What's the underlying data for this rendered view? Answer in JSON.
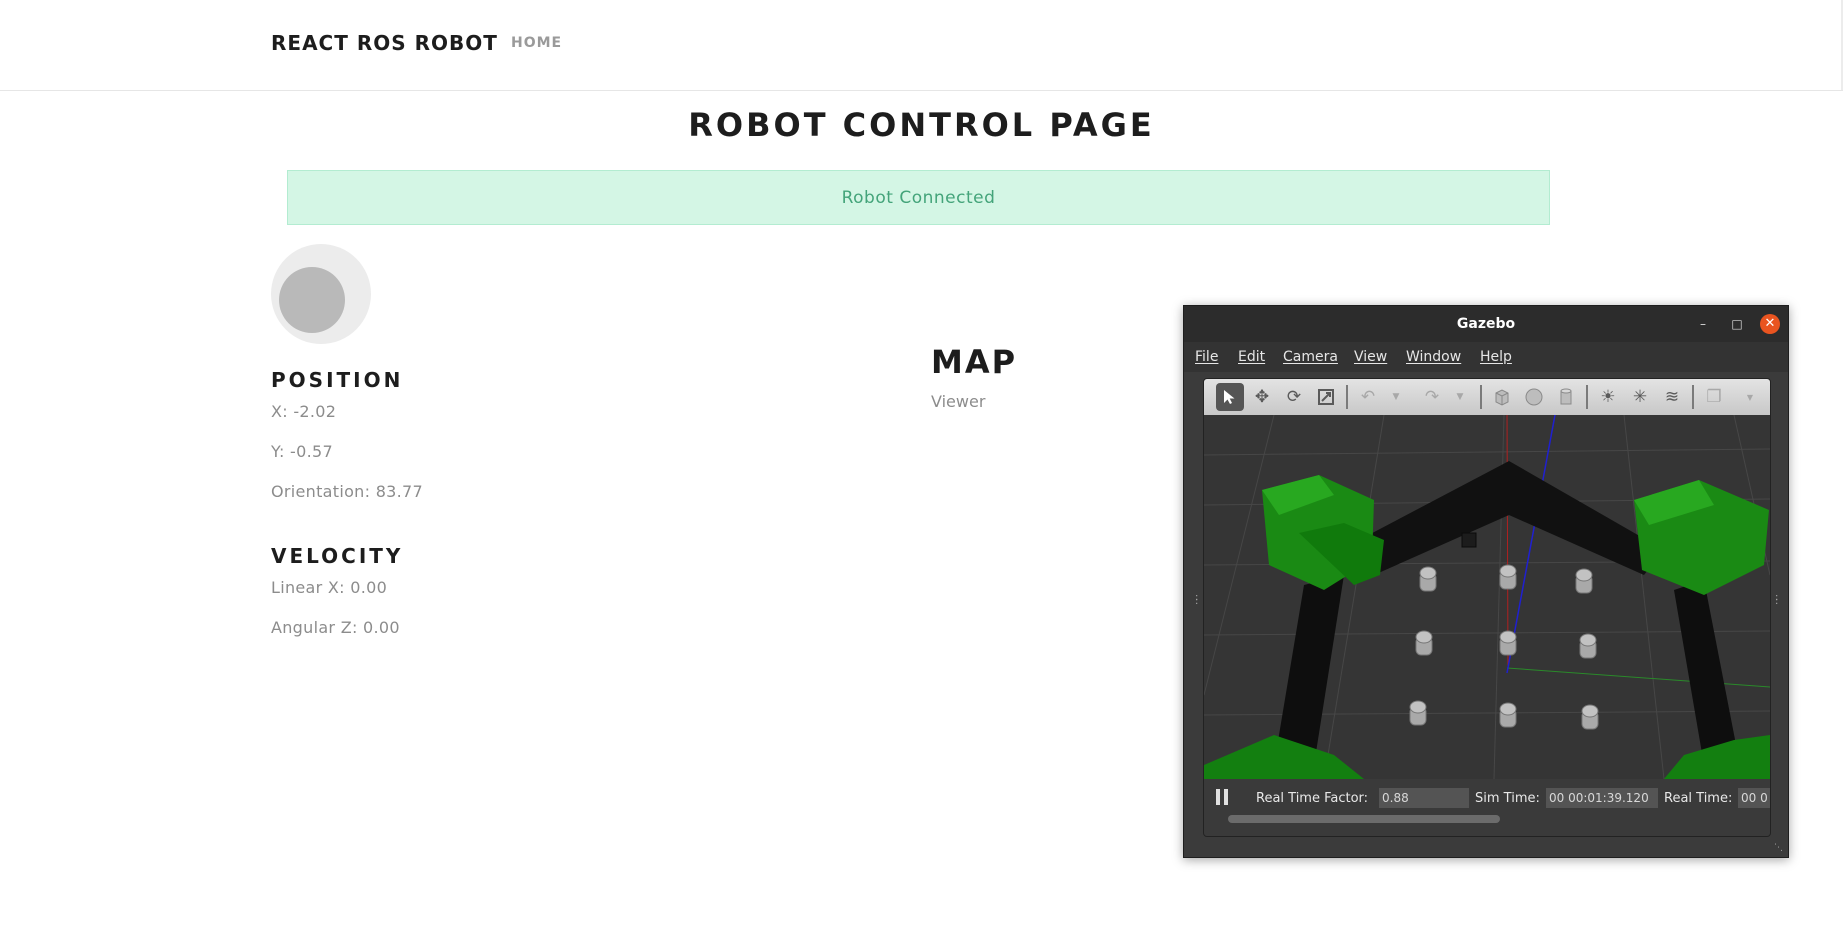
{
  "navbar": {
    "brand": "REACT ROS ROBOT",
    "home": "HOME"
  },
  "page": {
    "title": "ROBOT CONTROL PAGE",
    "alert": "Robot Connected"
  },
  "joystick": {
    "knob_offset": [
      0,
      0
    ]
  },
  "position": {
    "heading": "POSITION",
    "x": "X: -2.02",
    "y": "Y: -0.57",
    "orientation": "Orientation: 83.77"
  },
  "velocity": {
    "heading": "VELOCITY",
    "linear": "Linear X: 0.00",
    "angular": "Angular Z: 0.00"
  },
  "map": {
    "heading": "MAP",
    "subtitle": "Viewer"
  },
  "gazebo": {
    "title": "Gazebo",
    "menu": [
      "File",
      "Edit",
      "Camera",
      "View",
      "Window",
      "Help"
    ],
    "toolbar_icons": [
      "select-arrow-icon",
      "translate-icon",
      "rotate-icon",
      "scale-icon",
      "undo-icon",
      "redo-icon",
      "box-shape-icon",
      "sphere-shape-icon",
      "cylinder-shape-icon",
      "point-light-icon",
      "spot-light-icon",
      "directional-light-icon",
      "copy-icon"
    ],
    "real_time_factor_label": "Real Time Factor:",
    "real_time_factor": "0.88",
    "sim_time_label": "Sim Time:",
    "sim_time": "00 00:01:39.120",
    "real_time_label": "Real Time:",
    "real_time": "00 0"
  },
  "colors": {
    "alert_bg": "#d4f6e5",
    "alert_text": "#44a47a",
    "gazebo_close": "#e95420",
    "tree_green": "#1a8a14"
  }
}
